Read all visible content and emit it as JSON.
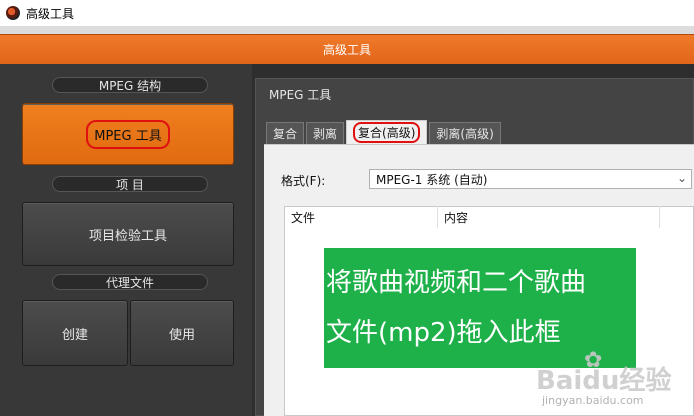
{
  "window": {
    "title": "高级工具"
  },
  "header": {
    "title": "高级工具"
  },
  "left": {
    "sections": [
      {
        "label": "MPEG 结构"
      },
      {
        "label": "项 目"
      },
      {
        "label": "代理文件"
      }
    ],
    "mpeg_tool_label": "MPEG 工具",
    "project_check_label": "项目检验工具",
    "create_label": "创建",
    "use_label": "使用"
  },
  "right": {
    "title": "MPEG 工具",
    "tabs": [
      {
        "label": "复合"
      },
      {
        "label": "剥离"
      },
      {
        "label": "复合(高级)"
      },
      {
        "label": "剥离(高级)"
      }
    ],
    "format_label": "格式(F):",
    "format_value": "MPEG-1 系统 (自动)",
    "columns": [
      "文件",
      "内容"
    ]
  },
  "overlay": {
    "line1": "将歌曲视频和二个歌曲",
    "line2": "文件(mp2)拖入此框"
  },
  "watermark": {
    "brand": "Baidu经验",
    "site": "jingyan.baidu.com"
  },
  "colors": {
    "accent": "#e8701c",
    "overlay": "#1eb14a",
    "highlight_ring": "#e01010"
  }
}
